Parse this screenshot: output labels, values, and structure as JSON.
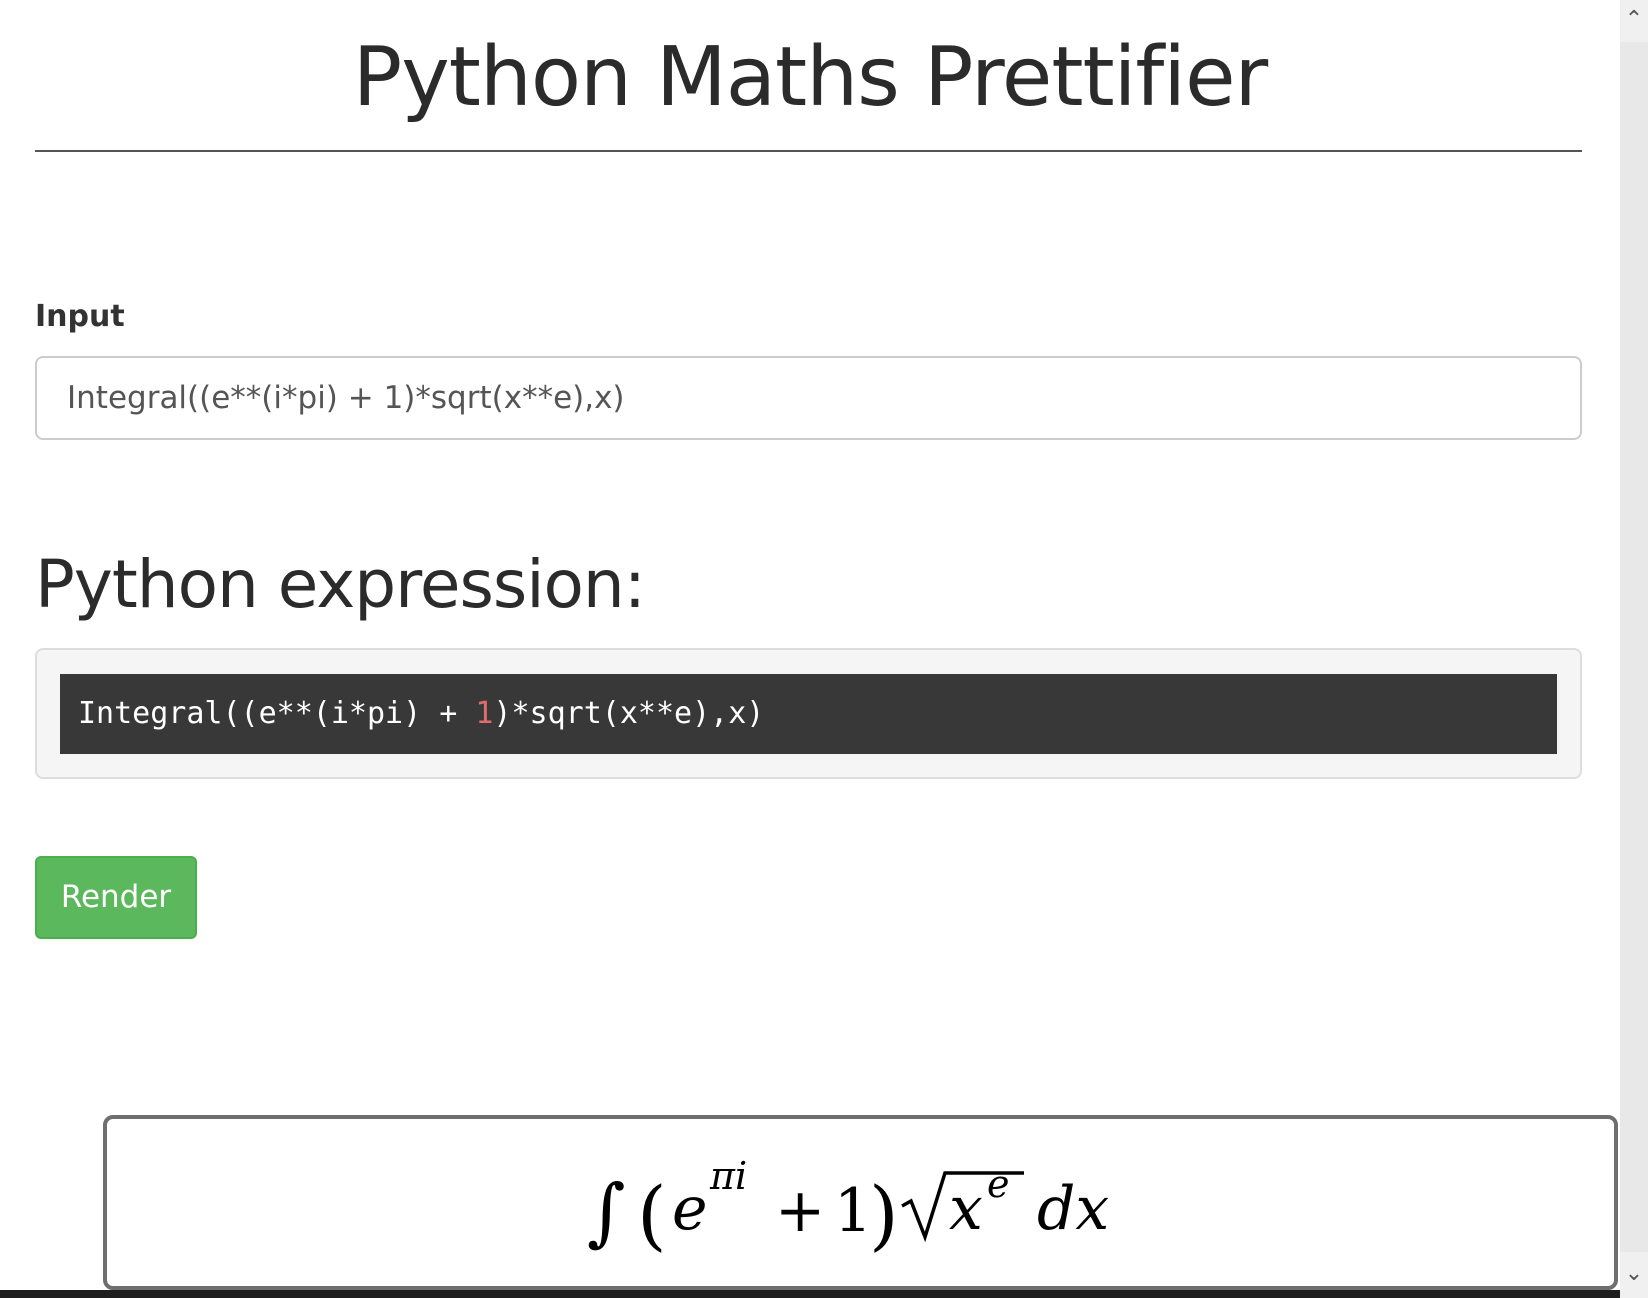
{
  "header": {
    "title": "Python Maths Prettifier"
  },
  "form": {
    "input_label": "Input",
    "input_value": "Integral((e**(i*pi) + 1)*sqrt(x**e),x)"
  },
  "expression": {
    "heading": "Python expression:",
    "code_before": "Integral((e**(i*pi) + ",
    "code_number": "1",
    "code_after": ")*sqrt(x**e),x)"
  },
  "actions": {
    "render_label": "Render"
  },
  "output": {
    "integral_sign": "∫",
    "open_paren": "(",
    "base_e": "e",
    "exponent": "πi",
    "plus": "+",
    "one": "1",
    "close_paren": ")",
    "radicand_base": "x",
    "radicand_exp": "e",
    "differential": "dx"
  },
  "scrollbar": {
    "up_icon": "chevron-up-icon",
    "down_icon": "chevron-down-icon"
  },
  "colors": {
    "button_green": "#5cb85c",
    "code_background": "#383838",
    "code_number": "#e06c6c"
  }
}
